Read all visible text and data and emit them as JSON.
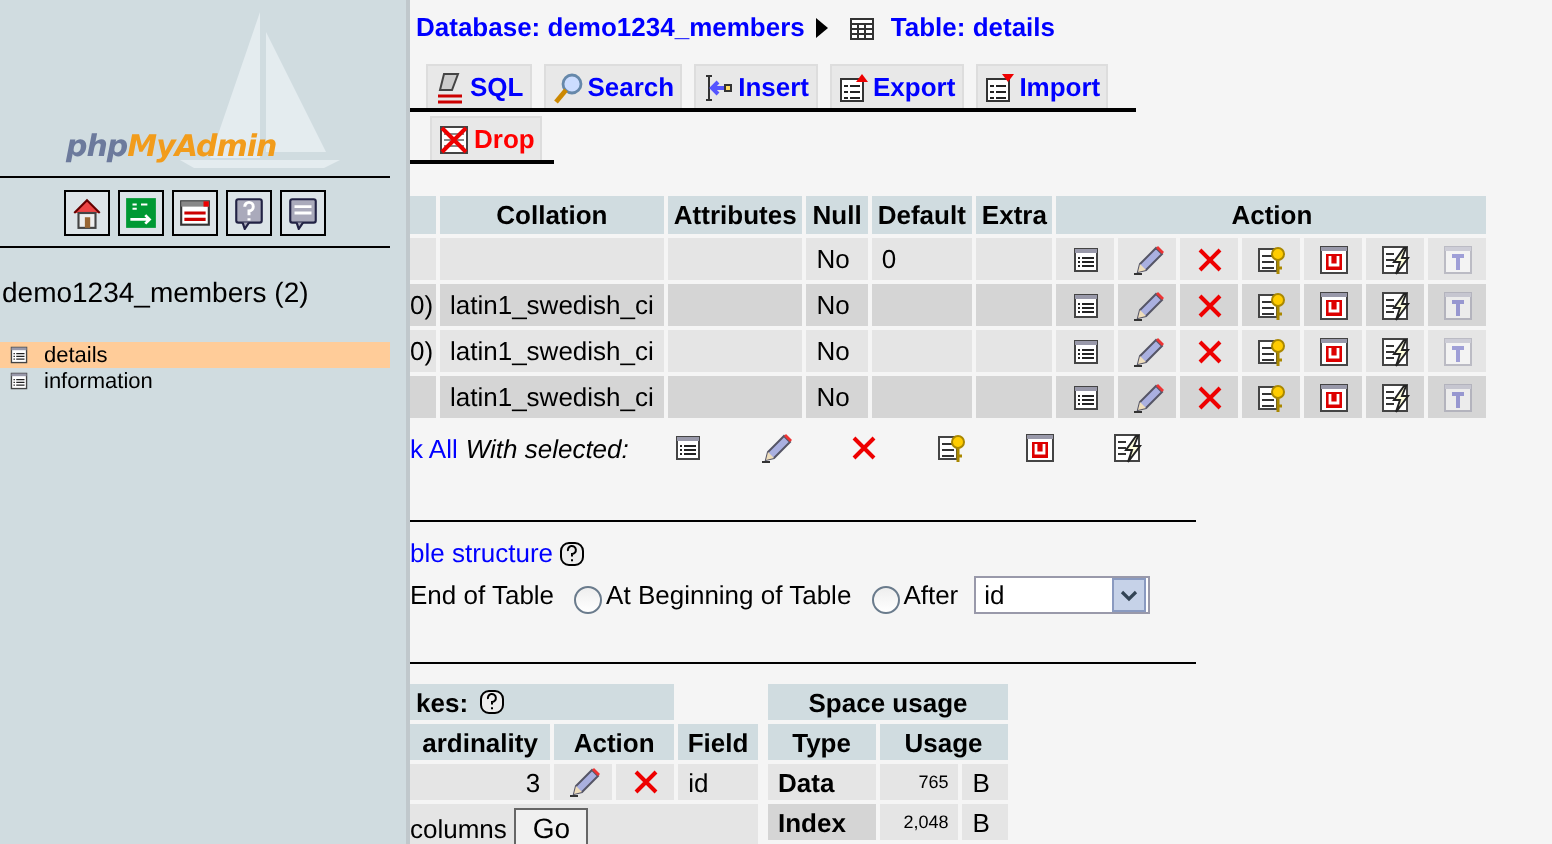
{
  "sidebar": {
    "logo": {
      "prefix": "php",
      "suffix": "MyAdmin"
    },
    "icon_buttons": [
      {
        "kind": "home"
      },
      {
        "kind": "exit"
      },
      {
        "kind": "query-window"
      },
      {
        "kind": "help"
      },
      {
        "kind": "sql-docs"
      }
    ],
    "database": "demo1234_members (2)",
    "tables": [
      {
        "name": "details",
        "selected": true
      },
      {
        "name": "information",
        "selected": false
      }
    ]
  },
  "breadcrumb": {
    "database": "Database: demo1234_members",
    "table": "Table: details"
  },
  "tabs": [
    {
      "label": "SQL",
      "kind": "sql"
    },
    {
      "label": "Search",
      "kind": "search"
    },
    {
      "label": "Insert",
      "kind": "insert"
    },
    {
      "label": "Export",
      "kind": "export"
    },
    {
      "label": "Import",
      "kind": "import"
    }
  ],
  "tabs_row_2": [
    {
      "label": "Drop",
      "kind": "drop-table"
    }
  ],
  "structure": {
    "columns": [
      "Collation",
      "Attributes",
      "Null",
      "Default",
      "Extra",
      "Action"
    ],
    "rows": [
      {
        "null": "No",
        "default": "0"
      },
      {
        "column_1": "0)",
        "collation": "latin1_swedish_ci",
        "null": "No"
      },
      {
        "column_1": "0)",
        "collation": "latin1_swedish_ci",
        "null": "No"
      },
      {
        "collation": "latin1_swedish_ci",
        "null": "No"
      }
    ],
    "actions": [
      {
        "kind": "browse",
        "disabled": false
      },
      {
        "kind": "edit",
        "disabled": false
      },
      {
        "kind": "drop",
        "disabled": false
      },
      {
        "kind": "primary",
        "disabled": false
      },
      {
        "kind": "unique",
        "disabled": false
      },
      {
        "kind": "index",
        "disabled": false
      },
      {
        "kind": "fulltext",
        "disabled": true
      }
    ],
    "check_all": "k All",
    "with_selected": "With selected:",
    "bulk_actions": [
      {
        "kind": "browse"
      },
      {
        "kind": "edit"
      },
      {
        "kind": "drop"
      },
      {
        "kind": "primary"
      },
      {
        "kind": "unique"
      },
      {
        "kind": "index"
      }
    ]
  },
  "add_field": {
    "link": "ble structure",
    "position_text": "End of Table",
    "radios": [
      {
        "label": "At Beginning of Table",
        "selected": false
      },
      {
        "label": "After",
        "selected": false
      }
    ],
    "after_field": "id"
  },
  "indexes": {
    "title": "kes:",
    "columns": [
      "ardinality",
      "Action",
      "Field"
    ],
    "rows": [
      {
        "cardinality": "3",
        "actions": [
          {
            "kind": "edit"
          },
          {
            "kind": "drop"
          }
        ],
        "field": "id"
      }
    ],
    "columns_label": "columns",
    "go": "Go"
  },
  "space_usage": {
    "title": "Space usage",
    "columns": [
      "Type",
      "Usage"
    ],
    "rows": [
      {
        "type": "Data",
        "usage": "765",
        "unit": "B"
      },
      {
        "type": "Index",
        "usage": "2,048",
        "unit": "B"
      }
    ]
  }
}
